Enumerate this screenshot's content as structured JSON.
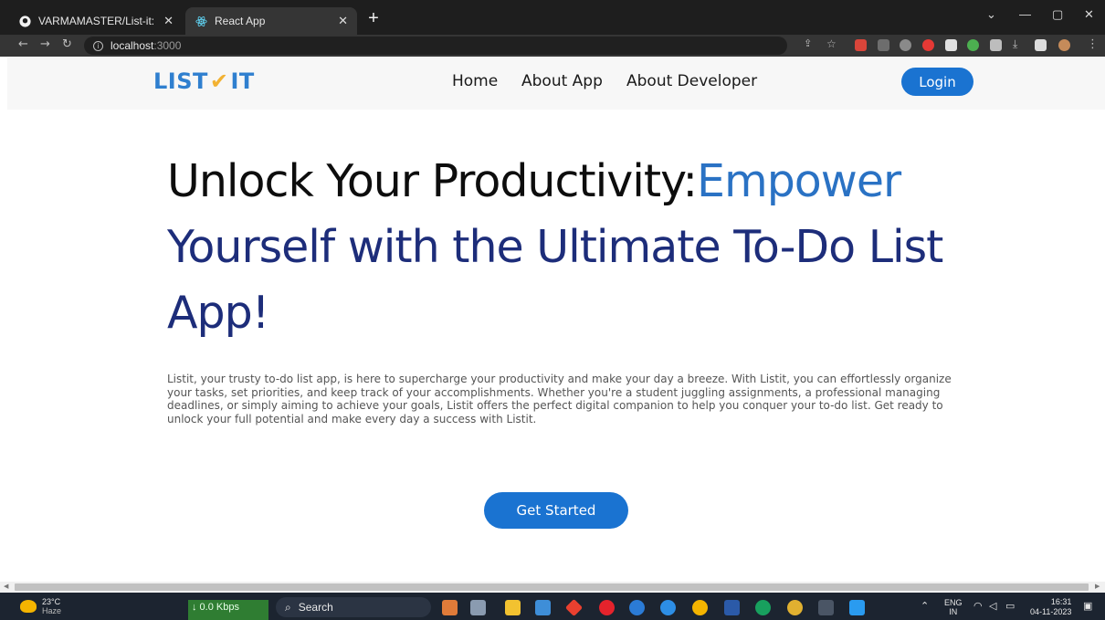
{
  "browser": {
    "tabs": [
      {
        "title": "VARMAMASTER/List-it: List it is a",
        "active": false
      },
      {
        "title": "React App",
        "active": true
      }
    ],
    "new_tab": "+",
    "window_controls": {
      "menu": "⌄",
      "minimize": "—",
      "restore": "▢",
      "close": "✕"
    },
    "url_host": "localhost",
    "url_port": ":3000"
  },
  "app": {
    "logo_left": "LIST",
    "logo_check": "✔",
    "logo_right": "IT",
    "nav": [
      "Home",
      "About App",
      "About Developer"
    ],
    "login_label": "Login",
    "hero": {
      "part1": "Unlock Your Productivity:",
      "part2": "Empower",
      "part3": "Yourself with the Ultimate To-Do List App!"
    },
    "description": "Listit, your trusty to-do list app, is here to supercharge your productivity and make your day a breeze. With Listit, you can effortlessly organize your tasks, set priorities, and keep track of your accomplishments. Whether you're a student juggling assignments, a professional managing deadlines, or simply aiming to achieve your goals, Listit offers the perfect digital companion to help you conquer your to-do list. Get ready to unlock your full potential and make every day a success with Listit.",
    "cta_label": "Get Started"
  },
  "taskbar": {
    "weather_temp": "23°C",
    "weather_desc": "Haze",
    "network_speed": "↓ 0.0 Kbps",
    "search_placeholder": "Search",
    "lang_top": "ENG",
    "lang_bottom": "IN",
    "time": "16:31",
    "date": "04-11-2023"
  },
  "colors": {
    "accent": "#1a73d1",
    "logo_blue": "#2f7fcf",
    "logo_check": "#f2b233",
    "hero_blue": "#2a72c4",
    "hero_dark": "#1d2d7a"
  }
}
